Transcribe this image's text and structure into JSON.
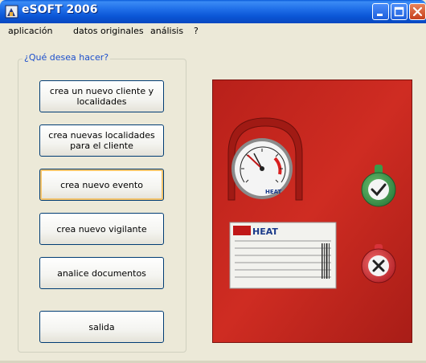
{
  "window": {
    "title": "eSOFT 2006"
  },
  "menu": [
    {
      "label": "aplicación"
    },
    {
      "label": "datos originales"
    },
    {
      "label": "análisis"
    },
    {
      "label": "?"
    }
  ],
  "group": {
    "legend": "¿Qué desea hacer?"
  },
  "buttons": [
    {
      "label": "crea un nuevo cliente y localidades"
    },
    {
      "label": "crea nuevas localidades para el cliente"
    },
    {
      "label": "crea nuevo evento"
    },
    {
      "label": "crea nuevo vigilante"
    },
    {
      "label": "analice documentos"
    },
    {
      "label": "salida"
    }
  ],
  "photo": {
    "gauge_brand": "HEAT",
    "label_brand": "HEAT"
  },
  "colors": {
    "title_bar": "#0b56d6",
    "group_legend": "#1c4fcc",
    "cabinet_red": "#c5281f",
    "tag_green": "#3a9a4a",
    "tag_red": "#d8333a"
  }
}
